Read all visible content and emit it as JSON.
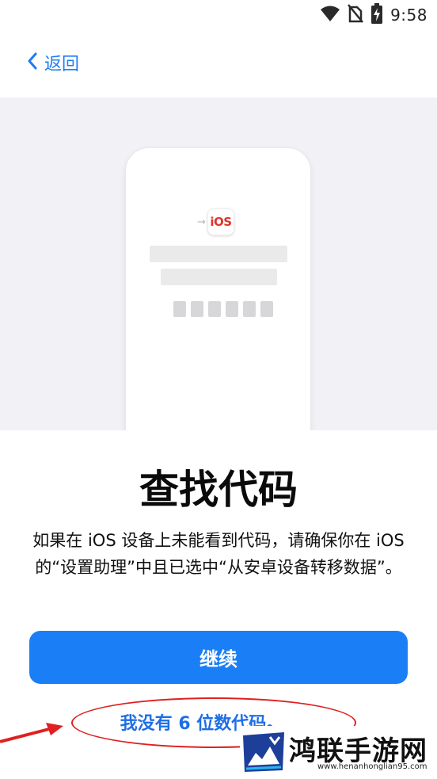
{
  "status_bar": {
    "time": "9:58"
  },
  "nav": {
    "back_label": "返回"
  },
  "illustration": {
    "ios_label": "iOS",
    "ios_arrow": "→"
  },
  "main": {
    "title": "查找代码",
    "description": "如果在 iOS 设备上未能看到代码，请确保你在 iOS 的“设置助理”中且已选中“从安卓设备转移数据”。",
    "continue_label": "继续",
    "no_code_link": "我没有 6 位数代码。"
  },
  "watermark": {
    "site_name": "鸿联手游网",
    "url": "www.henanhonglian95.com"
  },
  "colors": {
    "accent": "#1a7ff6",
    "link": "#1e6fe6",
    "annotation": "#e02020",
    "illustration_bg": "#f2f2f6"
  },
  "icons": [
    "wifi-icon",
    "no-sim-icon",
    "battery-charging-icon",
    "chevron-left-icon",
    "arrow-right-icon"
  ]
}
